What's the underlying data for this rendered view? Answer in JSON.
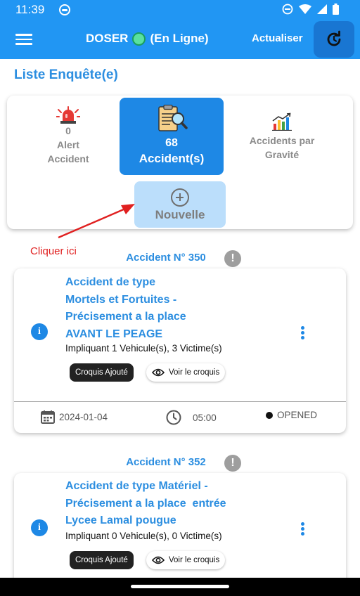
{
  "status_bar": {
    "time": "11:39"
  },
  "app_bar": {
    "title_main": "DOSER",
    "title_status": "(En Ligne)",
    "refresh_label": "Actualiser"
  },
  "section_title": "Liste Enquête(e)",
  "summary": {
    "alert": {
      "count": "0",
      "label_line1": "Alert",
      "label_line2": "Accident"
    },
    "accidents": {
      "count": "68",
      "label": "Accident(s)"
    },
    "gravite": {
      "label_line1": "Accidents par",
      "label_line2": "Gravité"
    },
    "new_button_label": "Nouvelle"
  },
  "annotation": {
    "text": "Cliquer ici",
    "color": "#e02020"
  },
  "accidents": [
    {
      "header": "Accident N° 350",
      "title_lines": [
        "Accident de type",
        "Mortels et Fortuites -",
        "Précisement a la place",
        "AVANT LE PEAGE"
      ],
      "meta": "Impliquant 1 Vehicule(s), 3 Victime(s)",
      "chip_added": "Croquis Ajouté",
      "chip_view": "Voir le croquis",
      "date": "2024-01-04",
      "time": "05:00",
      "status": "OPENED"
    },
    {
      "header": "Accident N° 352",
      "title_lines": [
        "Accident de type Matériel -",
        "Précisement a la place  entrée",
        "Lycee Lamal pougue"
      ],
      "meta": "Impliquant 0 Vehicule(s), 0 Victime(s)",
      "chip_added": "Croquis Ajouté",
      "chip_view": "Voir le croquis"
    }
  ],
  "colors": {
    "primary": "#2196f3",
    "accent_dark": "#1976d2",
    "title_blue": "#2c8ee0",
    "online": "#59e1a0"
  },
  "icons": [
    "menu-icon",
    "refresh-icon",
    "siren-icon",
    "clipboard-search-icon",
    "bar-chart-icon",
    "plus-circle-icon",
    "warning-icon",
    "info-icon",
    "more-vert-icon",
    "eye-icon",
    "calendar-icon",
    "clock-icon"
  ]
}
